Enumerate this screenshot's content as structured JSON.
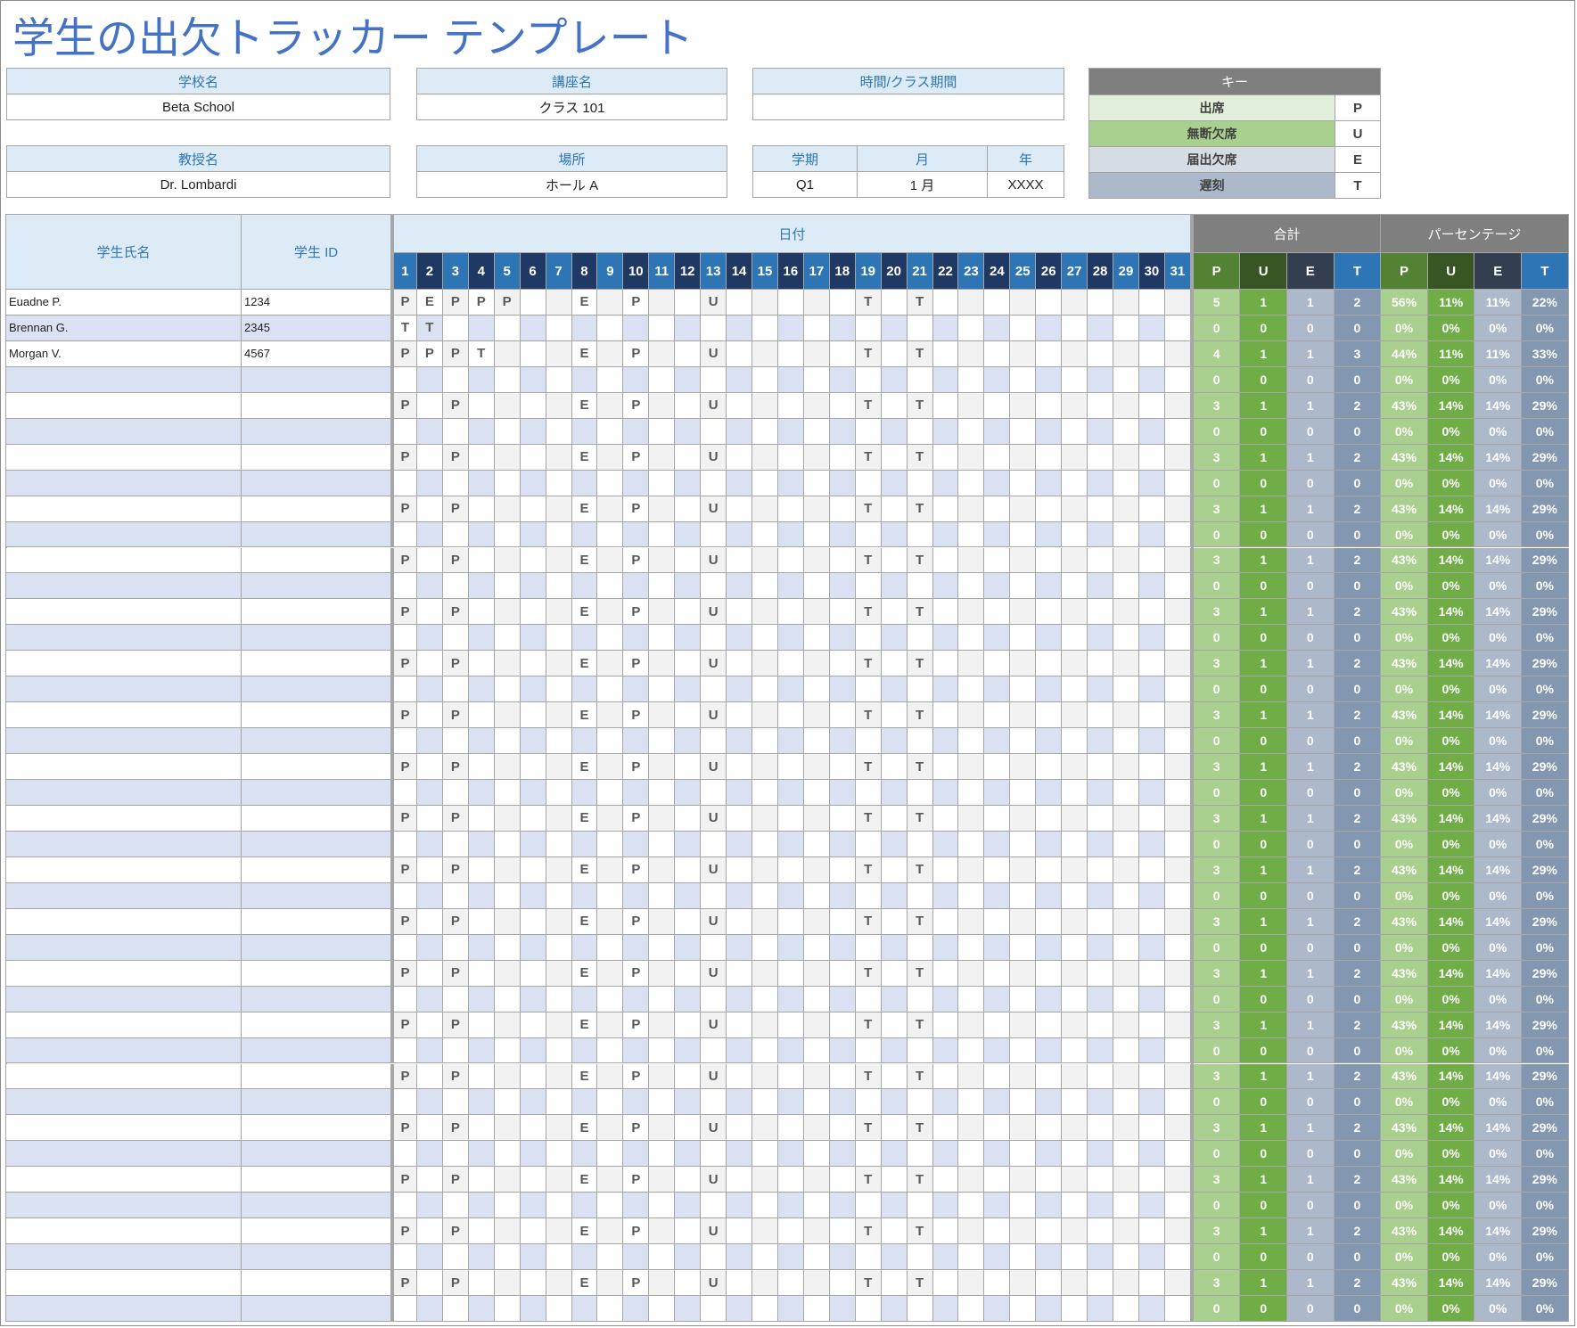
{
  "title": "学生の出欠トラッカー テンプレート",
  "info": {
    "school": {
      "label": "学校名",
      "value": "Beta School"
    },
    "course": {
      "label": "講座名",
      "value": "クラス 101"
    },
    "time": {
      "label": "時間/クラス期間",
      "value": ""
    },
    "professor": {
      "label": "教授名",
      "value": "Dr. Lombardi"
    },
    "location": {
      "label": "場所",
      "value": "ホール A"
    },
    "term": {
      "label": "学期",
      "value": "Q1"
    },
    "month": {
      "label": "月",
      "value": "1 月"
    },
    "year": {
      "label": "年",
      "value": "XXXX"
    }
  },
  "key": {
    "title": "キー",
    "items": [
      {
        "label": "出席",
        "code": "P",
        "color": "#e2efda"
      },
      {
        "label": "無断欠席",
        "code": "U",
        "color": "#a9d08e"
      },
      {
        "label": "届出欠席",
        "code": "E",
        "color": "#d6dce4"
      },
      {
        "label": "遅刻",
        "code": "T",
        "color": "#acb9ca"
      }
    ]
  },
  "table": {
    "name_header": "学生氏名",
    "id_header": "学生 ID",
    "date_header": "日付",
    "totals_header": "合計",
    "percent_header": "パーセンテージ",
    "days": [
      "1",
      "2",
      "3",
      "4",
      "5",
      "6",
      "7",
      "8",
      "9",
      "10",
      "11",
      "12",
      "13",
      "14",
      "15",
      "16",
      "17",
      "18",
      "19",
      "20",
      "21",
      "22",
      "23",
      "24",
      "25",
      "26",
      "27",
      "28",
      "29",
      "30",
      "31"
    ],
    "stat_columns": [
      "P",
      "U",
      "E",
      "T"
    ],
    "rows": [
      {
        "name": "Euadne P.",
        "id": "1234",
        "marks": {
          "1": "P",
          "2": "E",
          "3": "P",
          "4": "P",
          "5": "P",
          "8": "E",
          "10": "P",
          "13": "U",
          "19": "T",
          "21": "T"
        },
        "totals": [
          "5",
          "1",
          "1",
          "2"
        ],
        "percents": [
          "56%",
          "11%",
          "11%",
          "22%"
        ]
      },
      {
        "name": "Brennan G.",
        "id": "2345",
        "marks": {
          "1": "T",
          "2": "T"
        },
        "totals": [
          "0",
          "0",
          "0",
          "0"
        ],
        "percents": [
          "0%",
          "0%",
          "0%",
          "0%"
        ]
      },
      {
        "name": "Morgan V.",
        "id": "4567",
        "marks": {
          "1": "P",
          "2": "P",
          "3": "P",
          "4": "T",
          "8": "E",
          "10": "P",
          "13": "U",
          "19": "T",
          "21": "T"
        },
        "totals": [
          "4",
          "1",
          "1",
          "3"
        ],
        "percents": [
          "44%",
          "11%",
          "11%",
          "33%"
        ]
      },
      {
        "name": "",
        "id": "",
        "marks": {},
        "totals": [
          "0",
          "0",
          "0",
          "0"
        ],
        "percents": [
          "0%",
          "0%",
          "0%",
          "0%"
        ]
      },
      {
        "name": "",
        "id": "",
        "marks": {
          "1": "P",
          "3": "P",
          "8": "E",
          "10": "P",
          "13": "U",
          "19": "T",
          "21": "T"
        },
        "totals": [
          "3",
          "1",
          "1",
          "2"
        ],
        "percents": [
          "43%",
          "14%",
          "14%",
          "29%"
        ]
      },
      {
        "name": "",
        "id": "",
        "marks": {},
        "totals": [
          "0",
          "0",
          "0",
          "0"
        ],
        "percents": [
          "0%",
          "0%",
          "0%",
          "0%"
        ]
      },
      {
        "name": "",
        "id": "",
        "marks": {
          "1": "P",
          "3": "P",
          "8": "E",
          "10": "P",
          "13": "U",
          "19": "T",
          "21": "T"
        },
        "totals": [
          "3",
          "1",
          "1",
          "2"
        ],
        "percents": [
          "43%",
          "14%",
          "14%",
          "29%"
        ]
      },
      {
        "name": "",
        "id": "",
        "marks": {},
        "totals": [
          "0",
          "0",
          "0",
          "0"
        ],
        "percents": [
          "0%",
          "0%",
          "0%",
          "0%"
        ]
      },
      {
        "name": "",
        "id": "",
        "marks": {
          "1": "P",
          "3": "P",
          "8": "E",
          "10": "P",
          "13": "U",
          "19": "T",
          "21": "T"
        },
        "totals": [
          "3",
          "1",
          "1",
          "2"
        ],
        "percents": [
          "43%",
          "14%",
          "14%",
          "29%"
        ]
      },
      {
        "name": "",
        "id": "",
        "marks": {},
        "totals": [
          "0",
          "0",
          "0",
          "0"
        ],
        "percents": [
          "0%",
          "0%",
          "0%",
          "0%"
        ]
      },
      {
        "name": "",
        "id": "",
        "marks": {
          "1": "P",
          "3": "P",
          "8": "E",
          "10": "P",
          "13": "U",
          "19": "T",
          "21": "T"
        },
        "totals": [
          "3",
          "1",
          "1",
          "2"
        ],
        "percents": [
          "43%",
          "14%",
          "14%",
          "29%"
        ]
      },
      {
        "name": "",
        "id": "",
        "marks": {},
        "totals": [
          "0",
          "0",
          "0",
          "0"
        ],
        "percents": [
          "0%",
          "0%",
          "0%",
          "0%"
        ]
      },
      {
        "name": "",
        "id": "",
        "marks": {
          "1": "P",
          "3": "P",
          "8": "E",
          "10": "P",
          "13": "U",
          "19": "T",
          "21": "T"
        },
        "totals": [
          "3",
          "1",
          "1",
          "2"
        ],
        "percents": [
          "43%",
          "14%",
          "14%",
          "29%"
        ]
      },
      {
        "name": "",
        "id": "",
        "marks": {},
        "totals": [
          "0",
          "0",
          "0",
          "0"
        ],
        "percents": [
          "0%",
          "0%",
          "0%",
          "0%"
        ]
      },
      {
        "name": "",
        "id": "",
        "marks": {
          "1": "P",
          "3": "P",
          "8": "E",
          "10": "P",
          "13": "U",
          "19": "T",
          "21": "T"
        },
        "totals": [
          "3",
          "1",
          "1",
          "2"
        ],
        "percents": [
          "43%",
          "14%",
          "14%",
          "29%"
        ]
      },
      {
        "name": "",
        "id": "",
        "marks": {},
        "totals": [
          "0",
          "0",
          "0",
          "0"
        ],
        "percents": [
          "0%",
          "0%",
          "0%",
          "0%"
        ]
      },
      {
        "name": "",
        "id": "",
        "marks": {
          "1": "P",
          "3": "P",
          "8": "E",
          "10": "P",
          "13": "U",
          "19": "T",
          "21": "T"
        },
        "totals": [
          "3",
          "1",
          "1",
          "2"
        ],
        "percents": [
          "43%",
          "14%",
          "14%",
          "29%"
        ]
      },
      {
        "name": "",
        "id": "",
        "marks": {},
        "totals": [
          "0",
          "0",
          "0",
          "0"
        ],
        "percents": [
          "0%",
          "0%",
          "0%",
          "0%"
        ]
      },
      {
        "name": "",
        "id": "",
        "marks": {
          "1": "P",
          "3": "P",
          "8": "E",
          "10": "P",
          "13": "U",
          "19": "T",
          "21": "T"
        },
        "totals": [
          "3",
          "1",
          "1",
          "2"
        ],
        "percents": [
          "43%",
          "14%",
          "14%",
          "29%"
        ]
      },
      {
        "name": "",
        "id": "",
        "marks": {},
        "totals": [
          "0",
          "0",
          "0",
          "0"
        ],
        "percents": [
          "0%",
          "0%",
          "0%",
          "0%"
        ]
      },
      {
        "name": "",
        "id": "",
        "marks": {
          "1": "P",
          "3": "P",
          "8": "E",
          "10": "P",
          "13": "U",
          "19": "T",
          "21": "T"
        },
        "totals": [
          "3",
          "1",
          "1",
          "2"
        ],
        "percents": [
          "43%",
          "14%",
          "14%",
          "29%"
        ]
      },
      {
        "name": "",
        "id": "",
        "marks": {},
        "totals": [
          "0",
          "0",
          "0",
          "0"
        ],
        "percents": [
          "0%",
          "0%",
          "0%",
          "0%"
        ]
      },
      {
        "name": "",
        "id": "",
        "marks": {
          "1": "P",
          "3": "P",
          "8": "E",
          "10": "P",
          "13": "U",
          "19": "T",
          "21": "T"
        },
        "totals": [
          "3",
          "1",
          "1",
          "2"
        ],
        "percents": [
          "43%",
          "14%",
          "14%",
          "29%"
        ]
      },
      {
        "name": "",
        "id": "",
        "marks": {},
        "totals": [
          "0",
          "0",
          "0",
          "0"
        ],
        "percents": [
          "0%",
          "0%",
          "0%",
          "0%"
        ]
      },
      {
        "name": "",
        "id": "",
        "marks": {
          "1": "P",
          "3": "P",
          "8": "E",
          "10": "P",
          "13": "U",
          "19": "T",
          "21": "T"
        },
        "totals": [
          "3",
          "1",
          "1",
          "2"
        ],
        "percents": [
          "43%",
          "14%",
          "14%",
          "29%"
        ]
      },
      {
        "name": "",
        "id": "",
        "marks": {},
        "totals": [
          "0",
          "0",
          "0",
          "0"
        ],
        "percents": [
          "0%",
          "0%",
          "0%",
          "0%"
        ]
      },
      {
        "name": "",
        "id": "",
        "marks": {
          "1": "P",
          "3": "P",
          "8": "E",
          "10": "P",
          "13": "U",
          "19": "T",
          "21": "T"
        },
        "totals": [
          "3",
          "1",
          "1",
          "2"
        ],
        "percents": [
          "43%",
          "14%",
          "14%",
          "29%"
        ]
      },
      {
        "name": "",
        "id": "",
        "marks": {},
        "totals": [
          "0",
          "0",
          "0",
          "0"
        ],
        "percents": [
          "0%",
          "0%",
          "0%",
          "0%"
        ]
      },
      {
        "name": "",
        "id": "",
        "marks": {
          "1": "P",
          "3": "P",
          "8": "E",
          "10": "P",
          "13": "U",
          "19": "T",
          "21": "T"
        },
        "totals": [
          "3",
          "1",
          "1",
          "2"
        ],
        "percents": [
          "43%",
          "14%",
          "14%",
          "29%"
        ]
      },
      {
        "name": "",
        "id": "",
        "marks": {},
        "totals": [
          "0",
          "0",
          "0",
          "0"
        ],
        "percents": [
          "0%",
          "0%",
          "0%",
          "0%"
        ]
      },
      {
        "name": "",
        "id": "",
        "marks": {
          "1": "P",
          "3": "P",
          "8": "E",
          "10": "P",
          "13": "U",
          "19": "T",
          "21": "T"
        },
        "totals": [
          "3",
          "1",
          "1",
          "2"
        ],
        "percents": [
          "43%",
          "14%",
          "14%",
          "29%"
        ]
      },
      {
        "name": "",
        "id": "",
        "marks": {},
        "totals": [
          "0",
          "0",
          "0",
          "0"
        ],
        "percents": [
          "0%",
          "0%",
          "0%",
          "0%"
        ]
      },
      {
        "name": "",
        "id": "",
        "marks": {
          "1": "P",
          "3": "P",
          "8": "E",
          "10": "P",
          "13": "U",
          "19": "T",
          "21": "T"
        },
        "totals": [
          "3",
          "1",
          "1",
          "2"
        ],
        "percents": [
          "43%",
          "14%",
          "14%",
          "29%"
        ]
      },
      {
        "name": "",
        "id": "",
        "marks": {},
        "totals": [
          "0",
          "0",
          "0",
          "0"
        ],
        "percents": [
          "0%",
          "0%",
          "0%",
          "0%"
        ]
      },
      {
        "name": "",
        "id": "",
        "marks": {
          "1": "P",
          "3": "P",
          "8": "E",
          "10": "P",
          "13": "U",
          "19": "T",
          "21": "T"
        },
        "totals": [
          "3",
          "1",
          "1",
          "2"
        ],
        "percents": [
          "43%",
          "14%",
          "14%",
          "29%"
        ]
      },
      {
        "name": "",
        "id": "",
        "marks": {},
        "totals": [
          "0",
          "0",
          "0",
          "0"
        ],
        "percents": [
          "0%",
          "0%",
          "0%",
          "0%"
        ]
      },
      {
        "name": "",
        "id": "",
        "marks": {
          "1": "P",
          "3": "P",
          "8": "E",
          "10": "P",
          "13": "U",
          "19": "T",
          "21": "T"
        },
        "totals": [
          "3",
          "1",
          "1",
          "2"
        ],
        "percents": [
          "43%",
          "14%",
          "14%",
          "29%"
        ]
      },
      {
        "name": "",
        "id": "",
        "marks": {},
        "totals": [
          "0",
          "0",
          "0",
          "0"
        ],
        "percents": [
          "0%",
          "0%",
          "0%",
          "0%"
        ]
      },
      {
        "name": "",
        "id": "",
        "marks": {
          "1": "P",
          "3": "P",
          "8": "E",
          "10": "P",
          "13": "U",
          "19": "T",
          "21": "T"
        },
        "totals": [
          "3",
          "1",
          "1",
          "2"
        ],
        "percents": [
          "43%",
          "14%",
          "14%",
          "29%"
        ]
      },
      {
        "name": "",
        "id": "",
        "marks": {},
        "totals": [
          "0",
          "0",
          "0",
          "0"
        ],
        "percents": [
          "0%",
          "0%",
          "0%",
          "0%"
        ]
      }
    ]
  },
  "colors": {
    "title": "#4472c4",
    "header_light_blue": "#ddebf7",
    "day_odd": "#2e75b6",
    "day_even": "#1f3864",
    "stat_header": [
      "#548235",
      "#375623",
      "#333f50",
      "#2e75b6"
    ],
    "stat_cells": [
      "#a9d08e",
      "#70ad47",
      "#acb9ca",
      "#8497b0"
    ],
    "row_alt": "#d9e1f2",
    "row_shade": "#f2f2f2"
  }
}
